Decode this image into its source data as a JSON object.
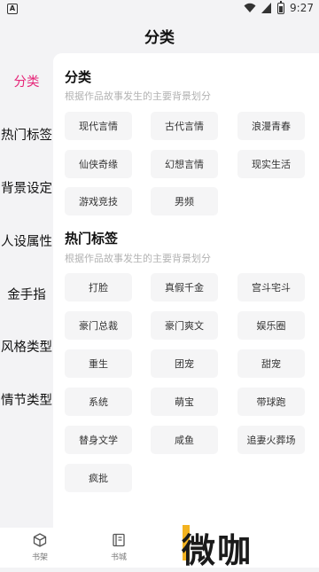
{
  "status_bar": {
    "left_icon_text": "A",
    "time": "9:27"
  },
  "page_title": "分类",
  "sidebar": {
    "items": [
      {
        "label": "分类",
        "active": true
      },
      {
        "label": "热门标签",
        "active": false
      },
      {
        "label": "背景设定",
        "active": false
      },
      {
        "label": "人设属性",
        "active": false
      },
      {
        "label": "金手指",
        "active": false
      },
      {
        "label": "风格类型",
        "active": false
      },
      {
        "label": "情节类型",
        "active": false
      }
    ]
  },
  "sections": [
    {
      "title": "分类",
      "subtitle": "根据作品故事发生的主要背景划分",
      "chips": [
        "现代言情",
        "古代言情",
        "浪漫青春",
        "仙侠奇缘",
        "幻想言情",
        "现实生活",
        "游戏竞技",
        "男频"
      ]
    },
    {
      "title": "热门标签",
      "subtitle": "根据作品故事发生的主要背景划分",
      "chips": [
        "打脸",
        "真假千金",
        "宫斗宅斗",
        "豪门总裁",
        "豪门爽文",
        "娱乐圈",
        "重生",
        "团宠",
        "甜宠",
        "系统",
        "萌宝",
        "带球跑",
        "替身文学",
        "咸鱼",
        "追妻火葬场",
        "疯批"
      ]
    }
  ],
  "bottom_nav": [
    {
      "label": "书架",
      "icon": "cube-icon"
    },
    {
      "label": "书城",
      "icon": "book-icon"
    }
  ],
  "watermark": "微咖",
  "colors": {
    "accent": "#e6287a",
    "background": "#f3f3f5",
    "chip": "#f5f5f6"
  }
}
